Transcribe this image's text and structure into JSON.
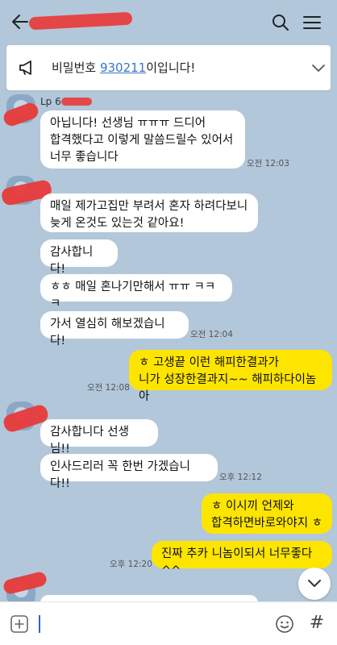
{
  "header": {
    "title": ""
  },
  "notice": {
    "prefix": "비밀번호 ",
    "code": "930211",
    "suffix": "이입니다!"
  },
  "messages": {
    "g1": {
      "sender": "Lp 6",
      "b1": "아닙니다! 선생님 ㅠㅠㅠ 드디어\n합격했다고 이렇게 말씀드릴수 있어서\n너무 좋습니다",
      "time": "오전 12:03"
    },
    "g2": {
      "b1": "매일 제가고집만 부려서 혼자 하려다보니\n늦게 온것도 있는것 같아요!",
      "b2": "감사합니다!",
      "b3": "ㅎㅎ 매일 혼나기만해서 ㅠㅠ ㅋㅋㅋ",
      "b4": "가서 열심히 해보겠습니다!",
      "time": "오전 12:04"
    },
    "me1": {
      "b1": "ㅎ 고생끝 이런 해피한결과가\n니가 성장한결과지~~ 해피하다이놈아",
      "time": "오전 12:08"
    },
    "g3": {
      "b1": "감사합니다 선생님!!",
      "b2": "인사드리러 꼭 한번 가겠습니다!!",
      "time": "오후 12:12"
    },
    "me2": {
      "b1": "ㅎ 이시끼  언제와\n합격하면바로와야지 ㅎ",
      "b2": "진짜 추카 니놈이되서 너무좋다^^",
      "time": "오후 12:20"
    }
  },
  "icons": {
    "back": "arrow-left-icon",
    "search": "search-icon",
    "menu": "hamburger-menu-icon",
    "notice": "megaphone-icon",
    "chevron": "chevron-down-icon",
    "plus": "plus-square-icon",
    "emoji": "smiley-icon",
    "hash": "hash-icon",
    "scroll": "chevron-down-icon"
  },
  "input": {
    "value": "",
    "hash_label": "#"
  },
  "colors": {
    "background": "#b2c7da",
    "my_bubble": "#fee500",
    "other_bubble": "#ffffff",
    "link": "#3b74c4",
    "redaction": "#e83a3a"
  }
}
